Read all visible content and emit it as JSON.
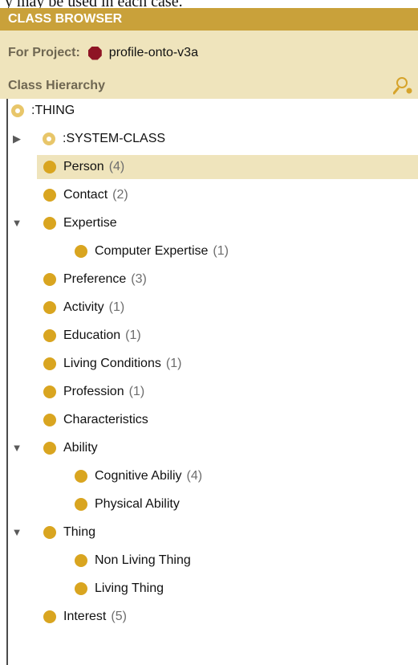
{
  "top_fragment": "y may be used in each case.",
  "panel": {
    "title": "CLASS BROWSER",
    "project_label": "For Project:",
    "project_icon": "hexagon-icon",
    "project_name": "profile-onto-v3a",
    "section_label": "Class Hierarchy",
    "search_icon": "search-class-icon",
    "colors": {
      "titlebar": "#c9a13a",
      "header_band": "#efe4bc",
      "bullet": "#d9a520",
      "project_icon": "#8e1424"
    }
  },
  "tree": [
    {
      "label": ":THING",
      "count": "",
      "icon": "system-class-icon"
    },
    {
      "label": ":SYSTEM-CLASS",
      "count": "",
      "icon": "system-class-icon",
      "toggle": "collapsed"
    },
    {
      "label": "Person",
      "count": "(4)",
      "icon": "class-icon",
      "selected": true
    },
    {
      "label": "Contact",
      "count": "(2)",
      "icon": "class-icon"
    },
    {
      "label": "Expertise",
      "count": "",
      "icon": "class-icon",
      "toggle": "expanded"
    },
    {
      "label": "Computer Expertise",
      "count": "(1)",
      "icon": "class-icon"
    },
    {
      "label": "Preference",
      "count": "(3)",
      "icon": "class-icon"
    },
    {
      "label": "Activity",
      "count": "(1)",
      "icon": "class-icon"
    },
    {
      "label": "Education",
      "count": "(1)",
      "icon": "class-icon"
    },
    {
      "label": "Living Conditions",
      "count": "(1)",
      "icon": "class-icon"
    },
    {
      "label": "Profession",
      "count": "(1)",
      "icon": "class-icon"
    },
    {
      "label": "Characteristics",
      "count": "",
      "icon": "class-icon"
    },
    {
      "label": "Ability",
      "count": "",
      "icon": "class-icon",
      "toggle": "expanded"
    },
    {
      "label": "Cognitive Abiliy",
      "count": "(4)",
      "icon": "class-icon"
    },
    {
      "label": "Physical Ability",
      "count": "",
      "icon": "class-icon"
    },
    {
      "label": "Thing",
      "count": "",
      "icon": "class-icon",
      "toggle": "expanded"
    },
    {
      "label": "Non Living Thing",
      "count": "",
      "icon": "class-icon"
    },
    {
      "label": "Living Thing",
      "count": "",
      "icon": "class-icon"
    },
    {
      "label": "Interest",
      "count": "(5)",
      "icon": "class-icon"
    }
  ]
}
